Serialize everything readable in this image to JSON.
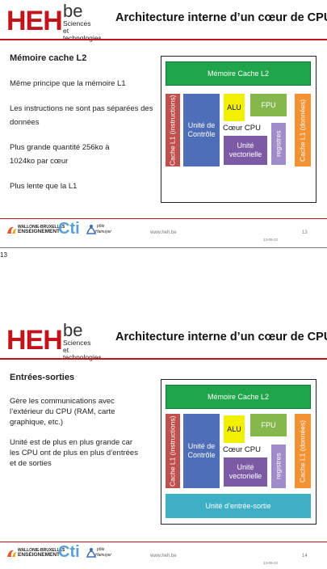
{
  "brand": {
    "heh": "HEH",
    "be": "be",
    "sciences": "Sciences",
    "tech": "et technologies"
  },
  "footer": {
    "wb": "WALLONIE-BRUXELLES",
    "enseignement": "ENSEIGNEMENT",
    "cti": "Cti",
    "pole1": "pôle",
    "pole2": "Hainuyer",
    "www": "www.heh.be",
    "date": "13-09-22"
  },
  "colors": {
    "accent": "#c4141b"
  },
  "slides": [
    {
      "title": "Architecture interne d’un cœur de CPU",
      "heading": "Mémoire cache L2",
      "paragraphs": [
        "Même principe que la mémoire L1",
        "Les instructions ne sont pas séparées des données",
        "Plus grande quantité 256ko à 1024ko par cœur",
        "Plus lente que la L1"
      ],
      "page": "13"
    },
    {
      "title": "Architecture interne d’un cœur de CPU",
      "heading": "Entrées-sorties",
      "paragraphs": [
        "Gère les communications avec l’extérieur du CPU (RAM, carte graphique, etc.)",
        "Unité est de plus en plus grande car les CPU ont de plus en plus d’entrées et de sorties"
      ],
      "page": "14"
    }
  ],
  "diagram": {
    "l2": "Mémoire Cache L2",
    "l1i": "Cache L1 (instructions)",
    "l1d": "Cache L1 (données)",
    "control": "Unité de Contrôle",
    "alu": "ALU",
    "fpu": "FPU",
    "core": "Cœur CPU",
    "vector": "Unité vectorielle",
    "registers": "registres",
    "io": "Unité d’entrée-sortie"
  },
  "page_label_below_first": "13"
}
